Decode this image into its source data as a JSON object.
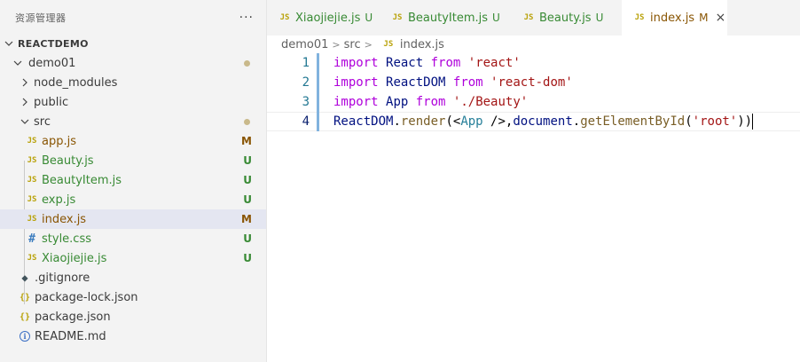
{
  "explorer": {
    "title": "资源管理器",
    "more": "···",
    "root": "REACTDEMO",
    "items": [
      {
        "label": "demo01",
        "kind": "folder",
        "status": "dot"
      },
      {
        "label": "node_modules",
        "kind": "folder"
      },
      {
        "label": "public",
        "kind": "folder"
      },
      {
        "label": "src",
        "kind": "folder",
        "status": "dot"
      },
      {
        "label": "app.js",
        "icon": "JS",
        "status": "M"
      },
      {
        "label": "Beauty.js",
        "icon": "JS",
        "status": "U"
      },
      {
        "label": "BeautyItem.js",
        "icon": "JS",
        "status": "U"
      },
      {
        "label": "exp.js",
        "icon": "JS",
        "status": "U"
      },
      {
        "label": "index.js",
        "icon": "JS",
        "status": "M"
      },
      {
        "label": "style.css",
        "icon": "#",
        "status": "U"
      },
      {
        "label": "Xiaojiejie.js",
        "icon": "JS",
        "status": "U"
      },
      {
        "label": ".gitignore",
        "icon": "git-icon"
      },
      {
        "label": "package-lock.json",
        "icon": "{}"
      },
      {
        "label": "package.json",
        "icon": "{}"
      },
      {
        "label": "README.md",
        "icon": "info-icon"
      }
    ]
  },
  "tabs": [
    {
      "icon": "JS",
      "label": "Xiaojiejie.js",
      "status": "U"
    },
    {
      "icon": "JS",
      "label": "BeautyItem.js",
      "status": "U"
    },
    {
      "icon": "JS",
      "label": "Beauty.js",
      "status": "U"
    },
    {
      "icon": "JS",
      "label": "index.js",
      "status": "M",
      "close": "×"
    }
  ],
  "breadcrumb": {
    "parts": [
      "demo01",
      "src",
      "index.js"
    ],
    "sep": ">",
    "icon": "JS"
  },
  "code": {
    "line_numbers": [
      "1",
      "2",
      "3",
      "4"
    ],
    "lines": [
      [
        {
          "t": "kw",
          "v": "import"
        },
        {
          "t": "punc",
          "v": " "
        },
        {
          "t": "id",
          "v": "React"
        },
        {
          "t": "punc",
          "v": " "
        },
        {
          "t": "kw",
          "v": "from"
        },
        {
          "t": "punc",
          "v": " "
        },
        {
          "t": "str",
          "v": "'react'"
        }
      ],
      [
        {
          "t": "kw",
          "v": "import"
        },
        {
          "t": "punc",
          "v": " "
        },
        {
          "t": "id",
          "v": "ReactDOM"
        },
        {
          "t": "punc",
          "v": " "
        },
        {
          "t": "kw",
          "v": "from"
        },
        {
          "t": "punc",
          "v": " "
        },
        {
          "t": "str",
          "v": "'react-dom'"
        }
      ],
      [
        {
          "t": "kw",
          "v": "import"
        },
        {
          "t": "punc",
          "v": " "
        },
        {
          "t": "id",
          "v": "App"
        },
        {
          "t": "punc",
          "v": " "
        },
        {
          "t": "kw",
          "v": "from"
        },
        {
          "t": "punc",
          "v": " "
        },
        {
          "t": "str",
          "v": "'./Beauty'"
        }
      ],
      [
        {
          "t": "id",
          "v": "ReactDOM"
        },
        {
          "t": "punc",
          "v": "."
        },
        {
          "t": "fn",
          "v": "render"
        },
        {
          "t": "punc",
          "v": "(<"
        },
        {
          "t": "tag",
          "v": "App"
        },
        {
          "t": "punc",
          "v": " />,"
        },
        {
          "t": "id",
          "v": "document"
        },
        {
          "t": "punc",
          "v": "."
        },
        {
          "t": "fn",
          "v": "getElementById"
        },
        {
          "t": "punc",
          "v": "("
        },
        {
          "t": "str",
          "v": "'root'"
        },
        {
          "t": "punc",
          "v": "))"
        }
      ]
    ]
  },
  "colors": {
    "modified": "#895503",
    "untracked": "#388a34",
    "selected_row": "#e4e6f1",
    "keyword": "#af00db",
    "string": "#a31515",
    "function": "#795e26"
  }
}
